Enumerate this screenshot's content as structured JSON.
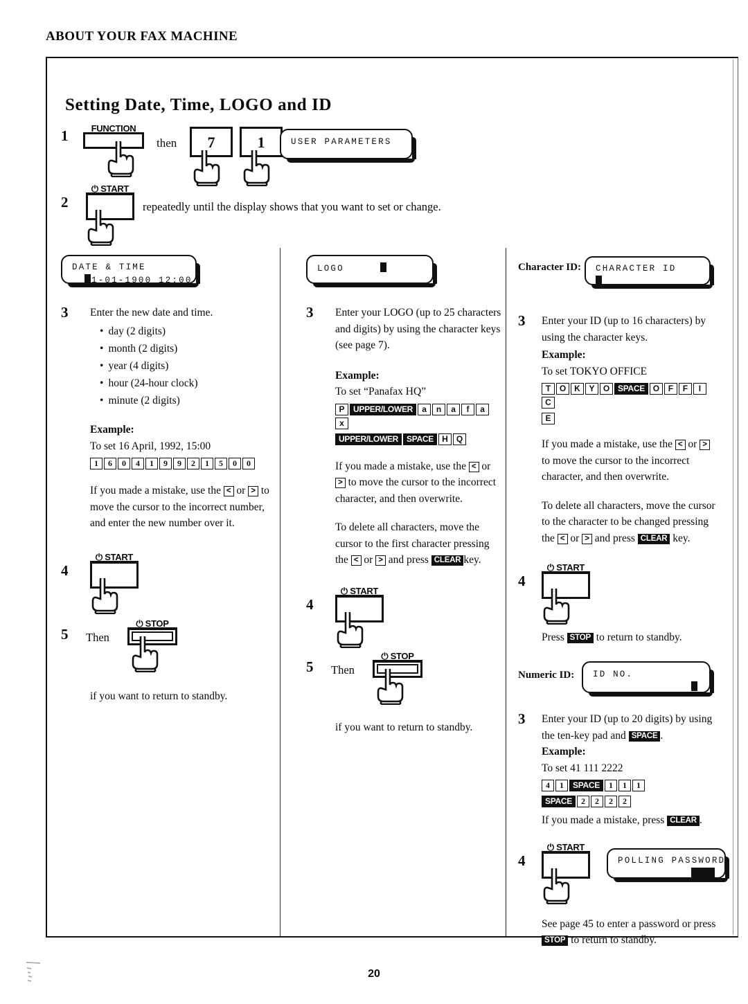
{
  "page": {
    "header": "ABOUT YOUR FAX MACHINE",
    "title": "Setting Date, Time, LOGO and ID",
    "page_number": "20"
  },
  "intro": {
    "step1": {
      "number": "1",
      "function_key_label": "FUNCTION",
      "then_text": "then",
      "key_7": "7",
      "key_1": "1",
      "lcd_line": "USER PARAMETERS"
    },
    "step2": {
      "number": "2",
      "start_key_label": "⏻ START",
      "text": "repeatedly until the display shows that you want to set or change."
    }
  },
  "columns": {
    "date_time": {
      "lcd": {
        "line1": "DATE & TIME",
        "line2_prefix": "  ",
        "line2": "1-01-1900 12:00"
      },
      "step3": {
        "number": "3",
        "heading": "Enter the new date and time.",
        "bullets": [
          "day (2 digits)",
          "month (2 digits)",
          "year (4 digits)",
          "hour (24-hour clock)",
          "minute (2 digits)"
        ],
        "example_label": "Example:",
        "example_text": "To set 16 April, 1992, 15:00",
        "key_sequence": [
          "1",
          "6",
          "0",
          "4",
          "1",
          "9",
          "9",
          "2",
          "1",
          "5",
          "0",
          "0"
        ],
        "mistake_text_a": "If you made a mistake, use the",
        "arrow_left": "<",
        "or_text": "or",
        "arrow_right": ">",
        "mistake_text_b": "to move the cursor to the incorrect number, and enter the new number over it."
      },
      "step4": {
        "number": "4",
        "start_key_label": "⏻ START"
      },
      "step5": {
        "number": "5",
        "then_text": "Then",
        "stop_key_label": "⏻ STOP",
        "tail_text": "if you want to return to standby."
      }
    },
    "logo": {
      "lcd": {
        "line1": "LOGO"
      },
      "step3": {
        "number": "3",
        "heading": "Enter your LOGO (up to 25 characters and digits) by using the character keys (see page 7).",
        "example_label": "Example:",
        "example_text": "To set “Panafax HQ”",
        "key_sequence_row1": [
          "P",
          "UPPER/LOWER",
          "a",
          "n",
          "a",
          "f",
          "a",
          "x"
        ],
        "key_sequence_row2": [
          "UPPER/LOWER",
          "SPACE",
          "H",
          "Q"
        ],
        "mistake_text_a": "If you made a mistake, use the",
        "arrow_left": "<",
        "or_text": "or",
        "arrow_right": ">",
        "mistake_text_b": "to move the cursor to the incorrect character, and then overwrite.",
        "delete_text_a": "To delete all characters, move the cursor to the first character pressing the",
        "delete_text_b": "and press",
        "clear_key": "CLEAR",
        "delete_text_c": "key."
      },
      "step4": {
        "number": "4",
        "start_key_label": "⏻ START"
      },
      "step5": {
        "number": "5",
        "then_text": "Then",
        "stop_key_label": "⏻ STOP",
        "tail_text": "if you want to return to standby."
      }
    },
    "id": {
      "character_id_label": "Character ID:",
      "lcd_char": {
        "line1": "CHARACTER ID"
      },
      "step3a": {
        "number": "3",
        "heading": "Enter your ID (up to 16 characters) by using the character keys.",
        "example_label": "Example:",
        "example_text": "To set TOKYO OFFICE",
        "key_sequence_row1": [
          "T",
          "O",
          "K",
          "Y",
          "O",
          "SPACE",
          "O",
          "F",
          "F",
          "I",
          "C"
        ],
        "key_sequence_row2": [
          "E"
        ],
        "mistake_text_a": "If you made a mistake, use the",
        "arrow_left": "<",
        "or_text": "or",
        "arrow_right": ">",
        "mistake_text_b": "to move the cursor to the incorrect character, and then overwrite.",
        "delete_text_a": "To delete all characters, move the cursor to the character to be changed pressing the",
        "delete_text_b": "and press",
        "clear_key": "CLEAR",
        "delete_text_c": "key."
      },
      "step4a": {
        "number": "4",
        "start_key_label": "⏻ START",
        "press_text_a": "Press",
        "stop_key": "STOP",
        "press_text_b": "to return to standby."
      },
      "numeric_id_label": "Numeric ID:",
      "lcd_numeric": {
        "line1": "ID NO."
      },
      "step3b": {
        "number": "3",
        "heading_a": "Enter your ID (up to 20 digits) by using the ten-key pad and",
        "space_key": "SPACE",
        "heading_b": ".",
        "example_label": "Example:",
        "example_text": "To set 41 111 2222",
        "key_sequence_row1": [
          "4",
          "1",
          "SPACE",
          "1",
          "1",
          "1"
        ],
        "key_sequence_row2": [
          "SPACE",
          "2",
          "2",
          "2",
          "2"
        ],
        "mistake_text_a": "If you made a mistake, press",
        "clear_key": "CLEAR",
        "mistake_text_b": "."
      },
      "step4b": {
        "number": "4",
        "start_key_label": "⏻ START",
        "lcd_polling": {
          "line1": "POLLING PASSWORD"
        },
        "tail_text_a": "See page 45 to enter a password or press",
        "stop_key": "STOP",
        "tail_text_b": "to return to standby."
      }
    }
  }
}
